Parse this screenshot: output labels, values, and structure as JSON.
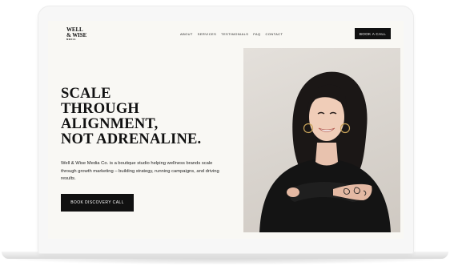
{
  "site": {
    "logo": {
      "line1": "WELL",
      "line2": "& WISE",
      "line3": "MEDIA"
    },
    "nav": [
      {
        "label": "ABOUT"
      },
      {
        "label": "SERVICES"
      },
      {
        "label": "TESTIMONIALS"
      },
      {
        "label": "FAQ"
      },
      {
        "label": "CONTACT"
      }
    ],
    "book_button": "BOOK A CALL"
  },
  "hero": {
    "headline": [
      "SCALE",
      "THROUGH",
      "ALIGNMENT,",
      "NOT ADRENALINE."
    ],
    "intro": "Well & Wise Media Co. is a boutique studio helping wellness brands scale through growth marketing – building strategy, running campaigns, and driving results.",
    "cta": "BOOK DISCOVERY CALL",
    "photo_icon": "portrait-photo"
  },
  "colors": {
    "page_bg": "#f9f8f4",
    "button_bg": "#111111",
    "text": "#111111"
  }
}
